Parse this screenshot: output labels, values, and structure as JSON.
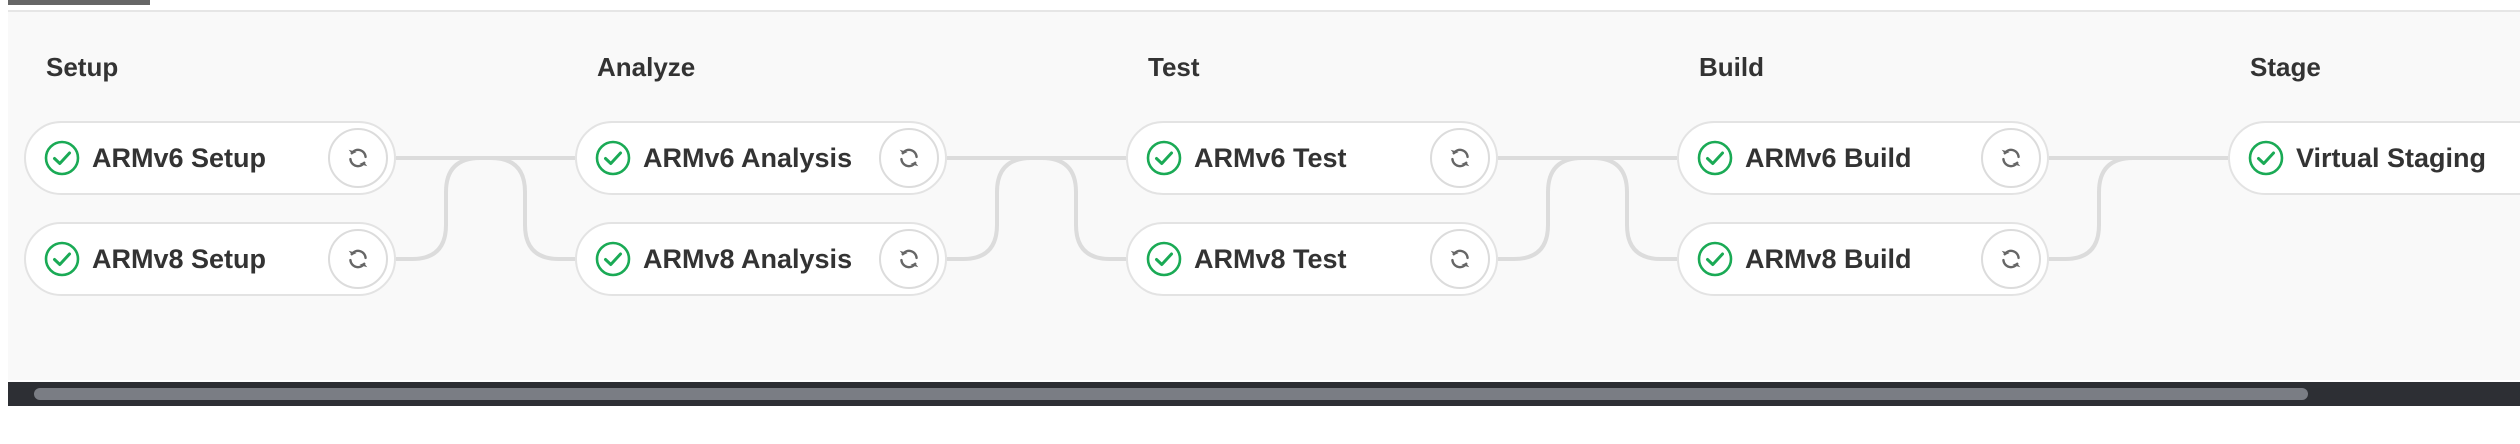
{
  "colors": {
    "success": "#1aaa55",
    "retry_icon": "#666666",
    "connector": "#dcdcdc"
  },
  "icons": {
    "status": "check-circle-icon",
    "action": "retry-icon"
  },
  "pipeline": {
    "stages": [
      {
        "title": "Setup",
        "jobs": [
          {
            "name": "ARMv6 Setup",
            "status": "success",
            "retry": true
          },
          {
            "name": "ARMv8 Setup",
            "status": "success",
            "retry": true
          }
        ]
      },
      {
        "title": "Analyze",
        "jobs": [
          {
            "name": "ARMv6 Analysis",
            "status": "success",
            "retry": true
          },
          {
            "name": "ARMv8 Analysis",
            "status": "success",
            "retry": true
          }
        ]
      },
      {
        "title": "Test",
        "jobs": [
          {
            "name": "ARMv6 Test",
            "status": "success",
            "retry": true
          },
          {
            "name": "ARMv8 Test",
            "status": "success",
            "retry": true
          }
        ]
      },
      {
        "title": "Build",
        "jobs": [
          {
            "name": "ARMv6 Build",
            "status": "success",
            "retry": true
          },
          {
            "name": "ARMv8 Build",
            "status": "success",
            "retry": true
          }
        ]
      },
      {
        "title": "Stage",
        "jobs": [
          {
            "name": "Virtual Staging",
            "status": "success",
            "retry": false
          }
        ]
      }
    ]
  }
}
